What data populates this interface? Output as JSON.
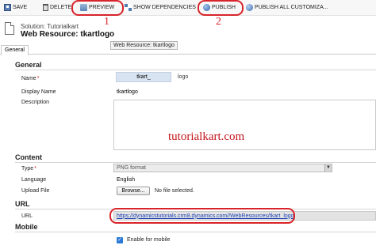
{
  "toolbar": {
    "save": "SAVE",
    "delete": "DELETE",
    "preview": "PREVIEW",
    "show_dependencies": "SHOW DEPENDENCIES",
    "publish": "PUBLISH",
    "publish_all": "PUBLISH ALL CUSTOMIZA..."
  },
  "annotations": {
    "one": "1",
    "two": "2",
    "watermark": "tutorialkart.com"
  },
  "header": {
    "solution": "Solution: Tutorialkart",
    "title": "Web Resource: tkartlogo",
    "tooltip": "Web Resource: tkartlogo"
  },
  "tabs": {
    "general": "General"
  },
  "sections": {
    "general": {
      "heading": "General",
      "name_label": "Name",
      "name_prefix": "tkart_",
      "name_value": "logo",
      "display_name_label": "Display Name",
      "display_name_value": "tkartlogo",
      "description_label": "Description"
    },
    "content": {
      "heading": "Content",
      "type_label": "Type",
      "type_value": "PNG format",
      "language_label": "Language",
      "language_value": "English",
      "upload_label": "Upload File",
      "browse_label": "Browse...",
      "no_file": "No file selected."
    },
    "url": {
      "heading": "URL",
      "url_label": "URL",
      "url_value": "https://dynamicstutorials.crm8.dynamics.com//WebResources/tkart_logo"
    },
    "mobile": {
      "heading": "Mobile",
      "enable_label": "Enable for mobile",
      "enable_checked": true
    }
  },
  "colors": {
    "annotation_red": "#d8242a",
    "link_blue": "#1a3fb3",
    "name_prefix_bg": "#d9e4f2"
  }
}
